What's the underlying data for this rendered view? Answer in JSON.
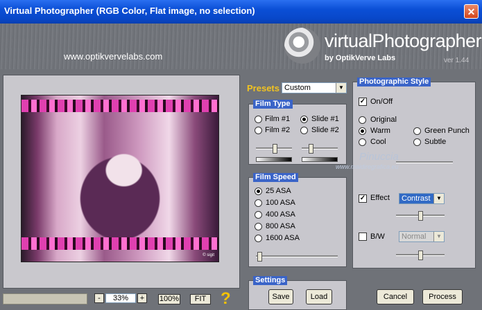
{
  "window": {
    "title": "Virtual Photographer (RGB Color, Flat image, no selection)",
    "close_glyph": "✕"
  },
  "header": {
    "url": "www.optikvervelabs.com",
    "logo_text": "virtualPhotographer",
    "logo_sub": "by OptikVerve Labs",
    "version": "ver 1.44"
  },
  "preview": {
    "signature": "© sigit"
  },
  "toolbar": {
    "zoom_minus": "-",
    "zoom_value": "33%",
    "zoom_plus": "+",
    "btn_100": "100%",
    "btn_fit": "FIT",
    "help": "?"
  },
  "presets": {
    "label": "Presets",
    "value": "Custom"
  },
  "film_type": {
    "title": "Film Type",
    "options": [
      "Film #1",
      "Slide #1",
      "Film #2",
      "Slide #2"
    ],
    "selected": "Slide #1"
  },
  "film_speed": {
    "title": "Film Speed",
    "options": [
      "25 ASA",
      "100 ASA",
      "400 ASA",
      "800 ASA",
      "1600 ASA"
    ],
    "selected": "25 ASA"
  },
  "settings": {
    "title": "Settings",
    "save": "Save",
    "load": "Load"
  },
  "photographic_style": {
    "title": "Photographic Style",
    "onoff_label": "On/Off",
    "onoff_checked": true,
    "styles": [
      "Original",
      "Warm",
      "Green Punch",
      "Cool",
      "Subtle"
    ],
    "selected": "Warm",
    "effect_label": "Effect",
    "effect_checked": true,
    "effect_value": "Contrast",
    "bw_label": "B/W",
    "bw_checked": false,
    "bw_value": "Normal"
  },
  "watermark": {
    "name": "Pinuccia",
    "site": "www.maidiregrafica.eu"
  },
  "actions": {
    "cancel": "Cancel",
    "process": "Process"
  }
}
